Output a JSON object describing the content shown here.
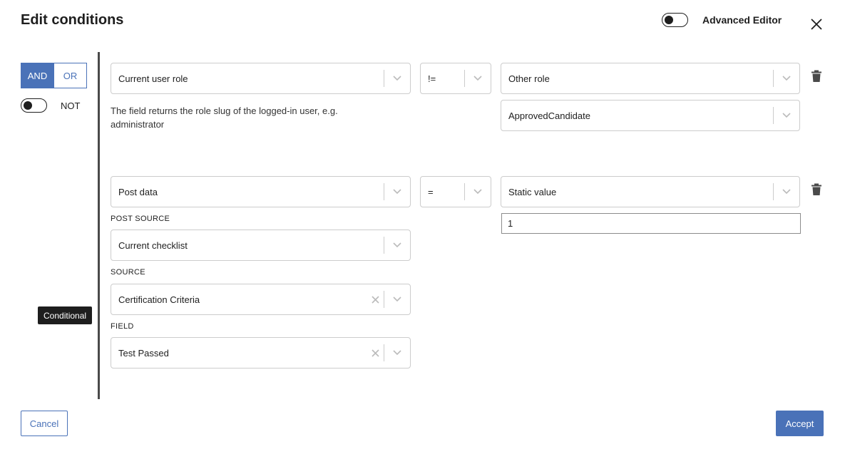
{
  "header": {
    "title": "Edit conditions",
    "advanced_editor_label": "Advanced Editor",
    "advanced_editor_on": false,
    "close_icon": "close-icon"
  },
  "logic": {
    "and_label": "AND",
    "or_label": "OR",
    "selected": "AND",
    "not_label": "NOT",
    "not_on": false
  },
  "conditions": [
    {
      "field": "Current user role",
      "operator": "!=",
      "value_type": "Other role",
      "value": "ApprovedCandidate",
      "help_text": "The field returns the role slug of the logged-in user, e.g. administrator",
      "delete_icon": "trash-icon"
    },
    {
      "field": "Post data",
      "operator": "=",
      "value_type": "Static value",
      "value": "1",
      "post_source_label": "POST SOURCE",
      "post_source": "Current checklist",
      "source_label": "SOURCE",
      "source": "Certification Criteria",
      "field_label": "FIELD",
      "field_value": "Test Passed",
      "delete_icon": "trash-icon"
    }
  ],
  "tooltip": "Conditional",
  "footer": {
    "cancel_label": "Cancel",
    "accept_label": "Accept"
  },
  "colors": {
    "accent": "#4a72b8",
    "text": "#1e1e1e",
    "border": "#cccccc"
  }
}
